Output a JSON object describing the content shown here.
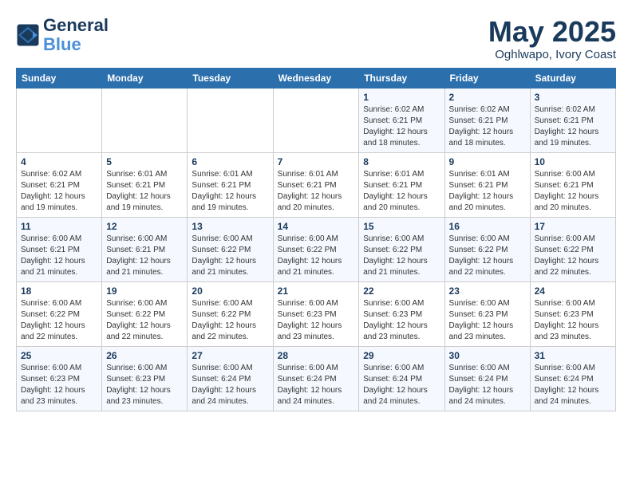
{
  "header": {
    "logo_line1": "General",
    "logo_line2": "Blue",
    "month": "May 2025",
    "location": "Oghlwapo, Ivory Coast"
  },
  "weekdays": [
    "Sunday",
    "Monday",
    "Tuesday",
    "Wednesday",
    "Thursday",
    "Friday",
    "Saturday"
  ],
  "weeks": [
    [
      {
        "day": "",
        "content": ""
      },
      {
        "day": "",
        "content": ""
      },
      {
        "day": "",
        "content": ""
      },
      {
        "day": "",
        "content": ""
      },
      {
        "day": "1",
        "content": "Sunrise: 6:02 AM\nSunset: 6:21 PM\nDaylight: 12 hours\nand 18 minutes."
      },
      {
        "day": "2",
        "content": "Sunrise: 6:02 AM\nSunset: 6:21 PM\nDaylight: 12 hours\nand 18 minutes."
      },
      {
        "day": "3",
        "content": "Sunrise: 6:02 AM\nSunset: 6:21 PM\nDaylight: 12 hours\nand 19 minutes."
      }
    ],
    [
      {
        "day": "4",
        "content": "Sunrise: 6:02 AM\nSunset: 6:21 PM\nDaylight: 12 hours\nand 19 minutes."
      },
      {
        "day": "5",
        "content": "Sunrise: 6:01 AM\nSunset: 6:21 PM\nDaylight: 12 hours\nand 19 minutes."
      },
      {
        "day": "6",
        "content": "Sunrise: 6:01 AM\nSunset: 6:21 PM\nDaylight: 12 hours\nand 19 minutes."
      },
      {
        "day": "7",
        "content": "Sunrise: 6:01 AM\nSunset: 6:21 PM\nDaylight: 12 hours\nand 20 minutes."
      },
      {
        "day": "8",
        "content": "Sunrise: 6:01 AM\nSunset: 6:21 PM\nDaylight: 12 hours\nand 20 minutes."
      },
      {
        "day": "9",
        "content": "Sunrise: 6:01 AM\nSunset: 6:21 PM\nDaylight: 12 hours\nand 20 minutes."
      },
      {
        "day": "10",
        "content": "Sunrise: 6:00 AM\nSunset: 6:21 PM\nDaylight: 12 hours\nand 20 minutes."
      }
    ],
    [
      {
        "day": "11",
        "content": "Sunrise: 6:00 AM\nSunset: 6:21 PM\nDaylight: 12 hours\nand 21 minutes."
      },
      {
        "day": "12",
        "content": "Sunrise: 6:00 AM\nSunset: 6:21 PM\nDaylight: 12 hours\nand 21 minutes."
      },
      {
        "day": "13",
        "content": "Sunrise: 6:00 AM\nSunset: 6:22 PM\nDaylight: 12 hours\nand 21 minutes."
      },
      {
        "day": "14",
        "content": "Sunrise: 6:00 AM\nSunset: 6:22 PM\nDaylight: 12 hours\nand 21 minutes."
      },
      {
        "day": "15",
        "content": "Sunrise: 6:00 AM\nSunset: 6:22 PM\nDaylight: 12 hours\nand 21 minutes."
      },
      {
        "day": "16",
        "content": "Sunrise: 6:00 AM\nSunset: 6:22 PM\nDaylight: 12 hours\nand 22 minutes."
      },
      {
        "day": "17",
        "content": "Sunrise: 6:00 AM\nSunset: 6:22 PM\nDaylight: 12 hours\nand 22 minutes."
      }
    ],
    [
      {
        "day": "18",
        "content": "Sunrise: 6:00 AM\nSunset: 6:22 PM\nDaylight: 12 hours\nand 22 minutes."
      },
      {
        "day": "19",
        "content": "Sunrise: 6:00 AM\nSunset: 6:22 PM\nDaylight: 12 hours\nand 22 minutes."
      },
      {
        "day": "20",
        "content": "Sunrise: 6:00 AM\nSunset: 6:22 PM\nDaylight: 12 hours\nand 22 minutes."
      },
      {
        "day": "21",
        "content": "Sunrise: 6:00 AM\nSunset: 6:23 PM\nDaylight: 12 hours\nand 23 minutes."
      },
      {
        "day": "22",
        "content": "Sunrise: 6:00 AM\nSunset: 6:23 PM\nDaylight: 12 hours\nand 23 minutes."
      },
      {
        "day": "23",
        "content": "Sunrise: 6:00 AM\nSunset: 6:23 PM\nDaylight: 12 hours\nand 23 minutes."
      },
      {
        "day": "24",
        "content": "Sunrise: 6:00 AM\nSunset: 6:23 PM\nDaylight: 12 hours\nand 23 minutes."
      }
    ],
    [
      {
        "day": "25",
        "content": "Sunrise: 6:00 AM\nSunset: 6:23 PM\nDaylight: 12 hours\nand 23 minutes."
      },
      {
        "day": "26",
        "content": "Sunrise: 6:00 AM\nSunset: 6:23 PM\nDaylight: 12 hours\nand 23 minutes."
      },
      {
        "day": "27",
        "content": "Sunrise: 6:00 AM\nSunset: 6:24 PM\nDaylight: 12 hours\nand 24 minutes."
      },
      {
        "day": "28",
        "content": "Sunrise: 6:00 AM\nSunset: 6:24 PM\nDaylight: 12 hours\nand 24 minutes."
      },
      {
        "day": "29",
        "content": "Sunrise: 6:00 AM\nSunset: 6:24 PM\nDaylight: 12 hours\nand 24 minutes."
      },
      {
        "day": "30",
        "content": "Sunrise: 6:00 AM\nSunset: 6:24 PM\nDaylight: 12 hours\nand 24 minutes."
      },
      {
        "day": "31",
        "content": "Sunrise: 6:00 AM\nSunset: 6:24 PM\nDaylight: 12 hours\nand 24 minutes."
      }
    ]
  ]
}
